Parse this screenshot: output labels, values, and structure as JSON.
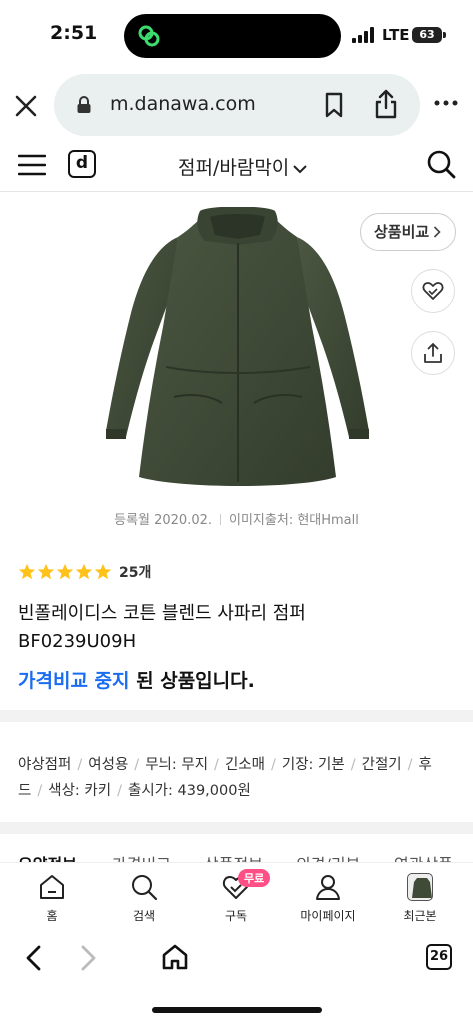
{
  "status": {
    "time": "2:51",
    "network": "LTE",
    "battery": "63"
  },
  "browser": {
    "url": "m.danawa.com",
    "tab_count": "26"
  },
  "header": {
    "logo_letter": "d",
    "category": "점퍼/바람막이"
  },
  "product": {
    "compare_label": "상품비교",
    "register_date": "등록월 2020.02.",
    "image_source": "이미지출처: 현대Hmall",
    "rating_stars": 5,
    "review_count": "25개",
    "name_line1": "빈폴레이디스 코튼 블렌드 사파리 점퍼",
    "name_line2": "BF0239U09H",
    "status_highlight": "가격비교 중지",
    "status_rest": " 된 상품입니다."
  },
  "specs": {
    "items": [
      "야상점퍼",
      "여성용",
      "무늬: 무지",
      "긴소매",
      "기장: 기본",
      "간절기",
      "후드",
      "색상: 카키",
      "출시가: 439,000원"
    ]
  },
  "tabs": [
    "요약정보",
    "가격비교",
    "상품정보",
    "의견/리뷰",
    "연관상품"
  ],
  "bottom_nav": {
    "home": "홈",
    "search": "검색",
    "subscribe": "구독",
    "free_badge": "무료",
    "mypage": "마이페이지",
    "recent": "최근본"
  },
  "colors": {
    "accent_blue": "#1a6cf0",
    "star": "#ffc21a",
    "badge_pink": "#ff4f84",
    "url_bar_bg": "#e9f0ef",
    "jacket": "#3f4a37"
  }
}
